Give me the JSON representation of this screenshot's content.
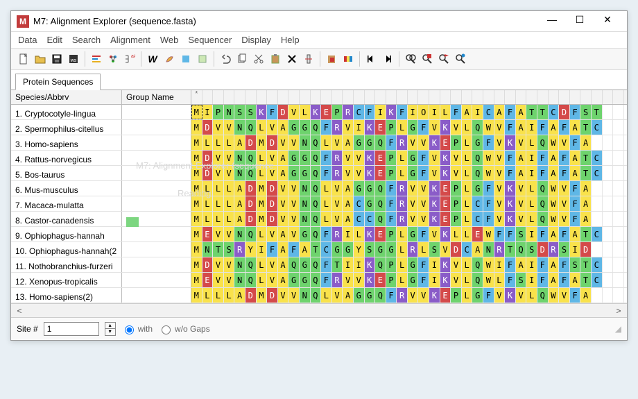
{
  "titlebar": {
    "icon_letter": "M",
    "title": "M7: Alignment Explorer (sequence.fasta)",
    "min": "—",
    "max": "☐",
    "close": "✕"
  },
  "menu": [
    "Data",
    "Edit",
    "Search",
    "Alignment",
    "Web",
    "Sequencer",
    "Display",
    "Help"
  ],
  "toolbar_icons": [
    "new-file-icon",
    "open-icon",
    "save-icon",
    "save-session-icon",
    "sep",
    "align-left-icon",
    "struct-icon",
    "tree-names-icon",
    "sep",
    "bold-w-icon",
    "muscle-icon",
    "block-icon",
    "block-light-icon",
    "sep",
    "undo-icon",
    "copy-icon",
    "cut-icon",
    "paste-icon",
    "delete-x-icon",
    "cut-col-icon",
    "sep",
    "color-paste-icon",
    "color-block-icon",
    "sep",
    "prev-icon",
    "next-icon",
    "sep",
    "find-icon",
    "mark-red-icon",
    "mark-flag-icon",
    "mark-pin-icon"
  ],
  "tab": "Protein Sequences",
  "columns": {
    "species": "Species/Abbrv",
    "group": "Group Name"
  },
  "ruler_first": "*",
  "rows": [
    {
      "n": 1,
      "name": "Cryptocotyle-lingua",
      "group": "",
      "seq": "MIPNSSKFDVLKEPRCFIKFIOILFAICAFATTCDFST"
    },
    {
      "n": 2,
      "name": "Spermophilus-citellus",
      "group": "",
      "seq": "MDVVNQLVAGGQFRVIKEPLGFVKVLQWVFAIFAFATC"
    },
    {
      "n": 3,
      "name": "Homo-sapiens",
      "group": "",
      "seq": "MLLLADMDVVNQLVAGGQFRVVKEPLGFVKVLQWVFA"
    },
    {
      "n": 4,
      "name": "Rattus-norvegicus",
      "group": "",
      "seq": "MDVVNQLVAGGQFRVVKEPLGFVKVLQWVFAIFAFATC"
    },
    {
      "n": 5,
      "name": "Bos-taurus",
      "group": "",
      "seq": "MDVVNQLVAGGQFRVVKEPLGFVKVLQWVFAIFAFATC"
    },
    {
      "n": 6,
      "name": "Mus-musculus",
      "group": "",
      "seq": "MLLLADMDVVNQLVAGGQFRVVKEPLGFVKVLQWVFA"
    },
    {
      "n": 7,
      "name": "Macaca-mulatta",
      "group": "",
      "seq": "MLLLADMDVVNQLVACGQFRVVKEPLCFVKVLQWVFA"
    },
    {
      "n": 8,
      "name": "Castor-canadensis",
      "group": "green",
      "seq": "MLLLADMDVVNQLVACCQFRVVKEPLCFVKVLQWVFA"
    },
    {
      "n": 9,
      "name": "Ophiophagus-hannah",
      "group": "",
      "seq": "MEVVNQLVAVGQFRILKEPLGFVKLLEWFFSIFAFATC"
    },
    {
      "n": 10,
      "name": "Ophiophagus-hannah(2",
      "group": "",
      "seq": "MNTSRYIFAFATCGGYSGGLRLSVDCANRTQSDRSID"
    },
    {
      "n": 11,
      "name": "Nothobranchius-furzeri",
      "group": "",
      "seq": "MDVVNQLVAQGQFTIIKQPLGFIKVLQWIFAIFAFSTC"
    },
    {
      "n": 12,
      "name": "Xenopus-tropicalis",
      "group": "",
      "seq": "MEVVNQLVAGGQFRVVKEPLGFIKVLQWLFSIFAFATC"
    },
    {
      "n": 13,
      "name": "Homo-sapiens(2)",
      "group": "",
      "seq": "MLLLADMDVVNQLVAGGQFRVVKEPLGFVKVLQWVFA"
    }
  ],
  "footer": {
    "site_label": "Site #",
    "site_value": "1",
    "with": "with",
    "without": "w/o Gaps"
  },
  "ghost": {
    "line1": "M7: Alignment Explorer (sequence.",
    "line2": "Reading"
  }
}
